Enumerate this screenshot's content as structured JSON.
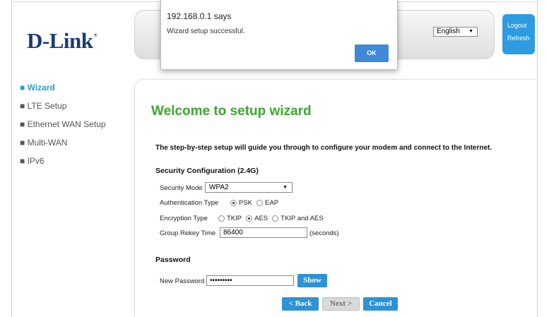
{
  "header": {
    "logo_text": "D-Link",
    "logo_mark": "®",
    "language": "English",
    "logout_label": "Logout",
    "refresh_label": "Refresh"
  },
  "sidebar": {
    "items": [
      {
        "label": "Wizard",
        "marker": "■",
        "active": true
      },
      {
        "label": "LTE Setup",
        "marker": "■",
        "active": false
      },
      {
        "label": "Ethernet WAN Setup",
        "marker": "■",
        "active": false
      },
      {
        "label": "Multi-WAN",
        "marker": "■",
        "active": false
      },
      {
        "label": "IPv6",
        "marker": "■",
        "active": false
      }
    ]
  },
  "main": {
    "title": "Welcome to setup wizard",
    "intro": "The step-by-step setup will guide you through to configure your modem and connect to the Internet.",
    "security_section": {
      "title": "Security Configuration  (2.4G)",
      "security_mode_label": "Security Mode",
      "security_mode_value": "WPA2",
      "auth_type_label": "Authentication Type",
      "auth_options": [
        "PSK",
        "EAP"
      ],
      "auth_selected": "PSK",
      "encryption_label": "Encryption Type",
      "encryption_options": [
        "TKIP",
        "AES",
        "TKIP and AES"
      ],
      "encryption_selected": "AES",
      "rekey_label": "Group Rekey Time",
      "rekey_value": "86400",
      "rekey_unit": "(seconds)"
    },
    "password_section": {
      "title": "Password",
      "new_password_label": "New Password",
      "new_password_value": "•••••••••",
      "show_label": "Show"
    },
    "buttons": {
      "back": "< Back",
      "next": "Next >",
      "cancel": "Cancel"
    }
  },
  "dialog": {
    "title": "192.168.0.1 says",
    "message": "Wizard setup successful.",
    "ok_label": "OK"
  },
  "colors": {
    "brand_blue": "#1a3d73",
    "accent_blue": "#2e93d6",
    "title_green": "#3aa82e",
    "nav_active": "#2a9fd6"
  }
}
